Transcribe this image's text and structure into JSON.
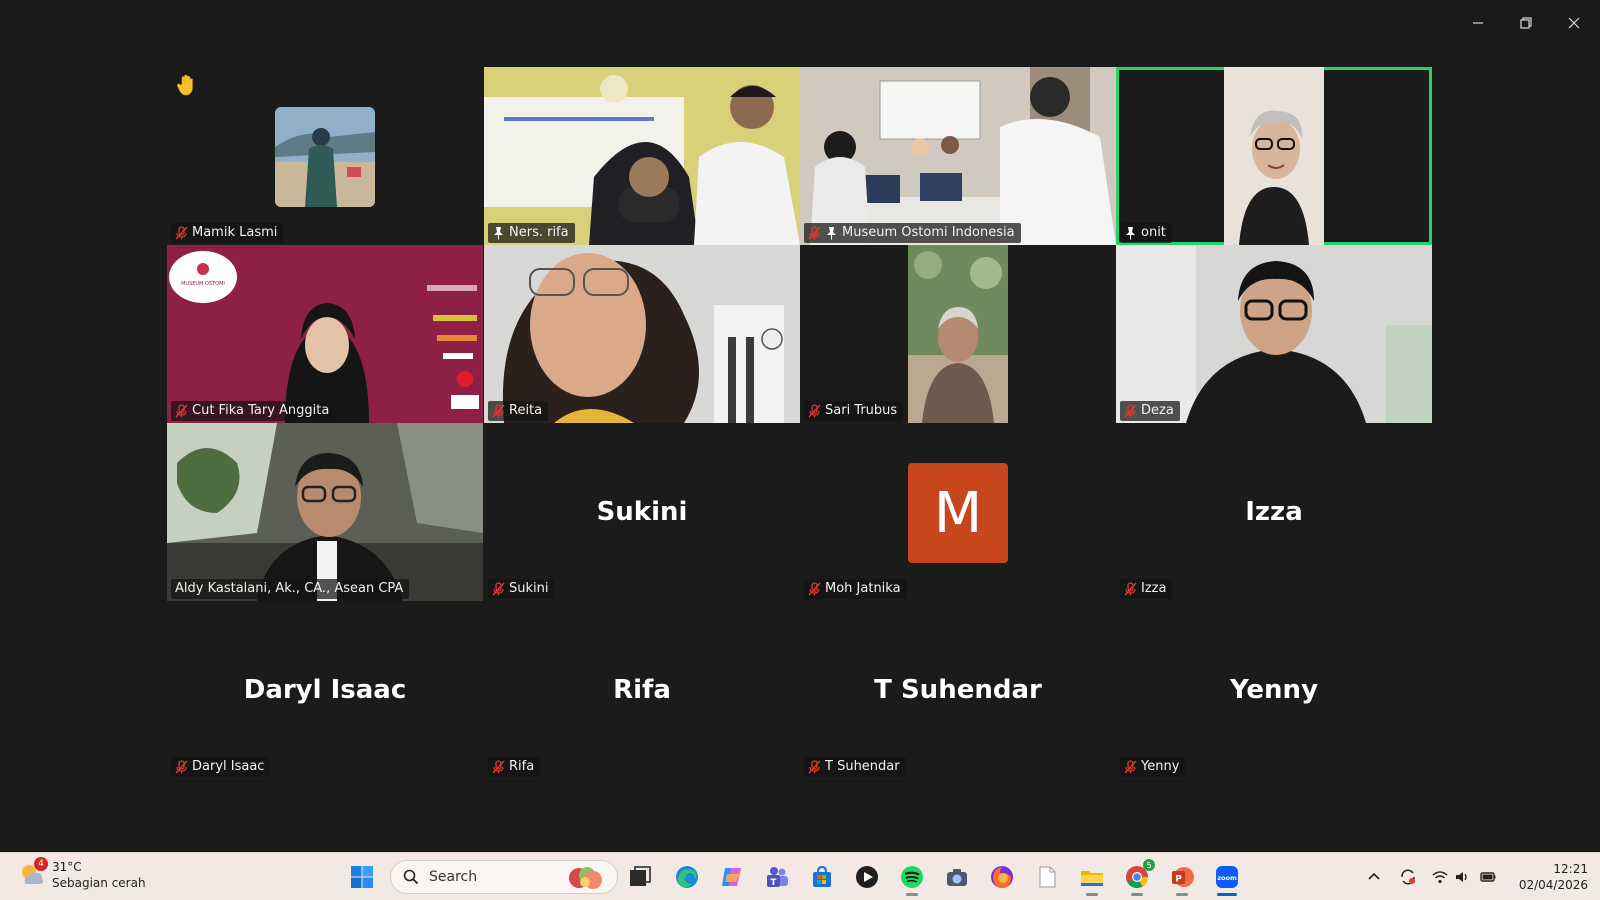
{
  "participants": [
    {
      "name": "Mamik Lasmi",
      "muted": true
    },
    {
      "name": "Ners. rifa",
      "pinned": true
    },
    {
      "name": "Museum Ostomi Indonesia",
      "muted": true,
      "pinned": true
    },
    {
      "name": "onit",
      "pinned": true,
      "active": true
    },
    {
      "name": "Cut Fika Tary Anggita",
      "muted": true
    },
    {
      "name": "Reita",
      "muted": true
    },
    {
      "name": "Sari Trubus",
      "muted": true
    },
    {
      "name": "Deza",
      "muted": true
    },
    {
      "name": "Aldy Kastalani, Ak., CA., Asean CPA"
    },
    {
      "name": "Sukini",
      "muted": true,
      "display": "Sukini"
    },
    {
      "name": "Moh Jatnika",
      "muted": true,
      "avatar_letter": "M"
    },
    {
      "name": "Izza",
      "muted": true,
      "display": "Izza"
    },
    {
      "name": "Daryl Isaac",
      "muted": true,
      "display": "Daryl Isaac"
    },
    {
      "name": "Rifa",
      "muted": true,
      "display": "Rifa"
    },
    {
      "name": "T Suhendar",
      "muted": true,
      "display": "T Suhendar"
    },
    {
      "name": "Yenny",
      "muted": true,
      "display": "Yenny"
    }
  ],
  "cut_fika_banner": {
    "logo_text": "MUSEUM OSTOMI"
  },
  "taskbar": {
    "weather": {
      "temp": "31°C",
      "desc": "Sebagian cerah",
      "badge": "4"
    },
    "search_label": "Search",
    "chrome_badge": "5",
    "time": "12:21",
    "date": "02/04/2026",
    "apps": [
      "start-icon",
      "search-icon",
      "task-view-icon",
      "edge-icon",
      "copilot-icon",
      "teams-icon",
      "store-icon",
      "media-player-icon",
      "spotify-icon",
      "camera-icon",
      "firefox-icon",
      "notepad-icon",
      "file-explorer-icon",
      "chrome-icon",
      "powerpoint-icon",
      "zoom-icon"
    ]
  },
  "colors": {
    "accent": "#25d36a",
    "avatar": "#c8461b",
    "mute": "#e0392d"
  }
}
